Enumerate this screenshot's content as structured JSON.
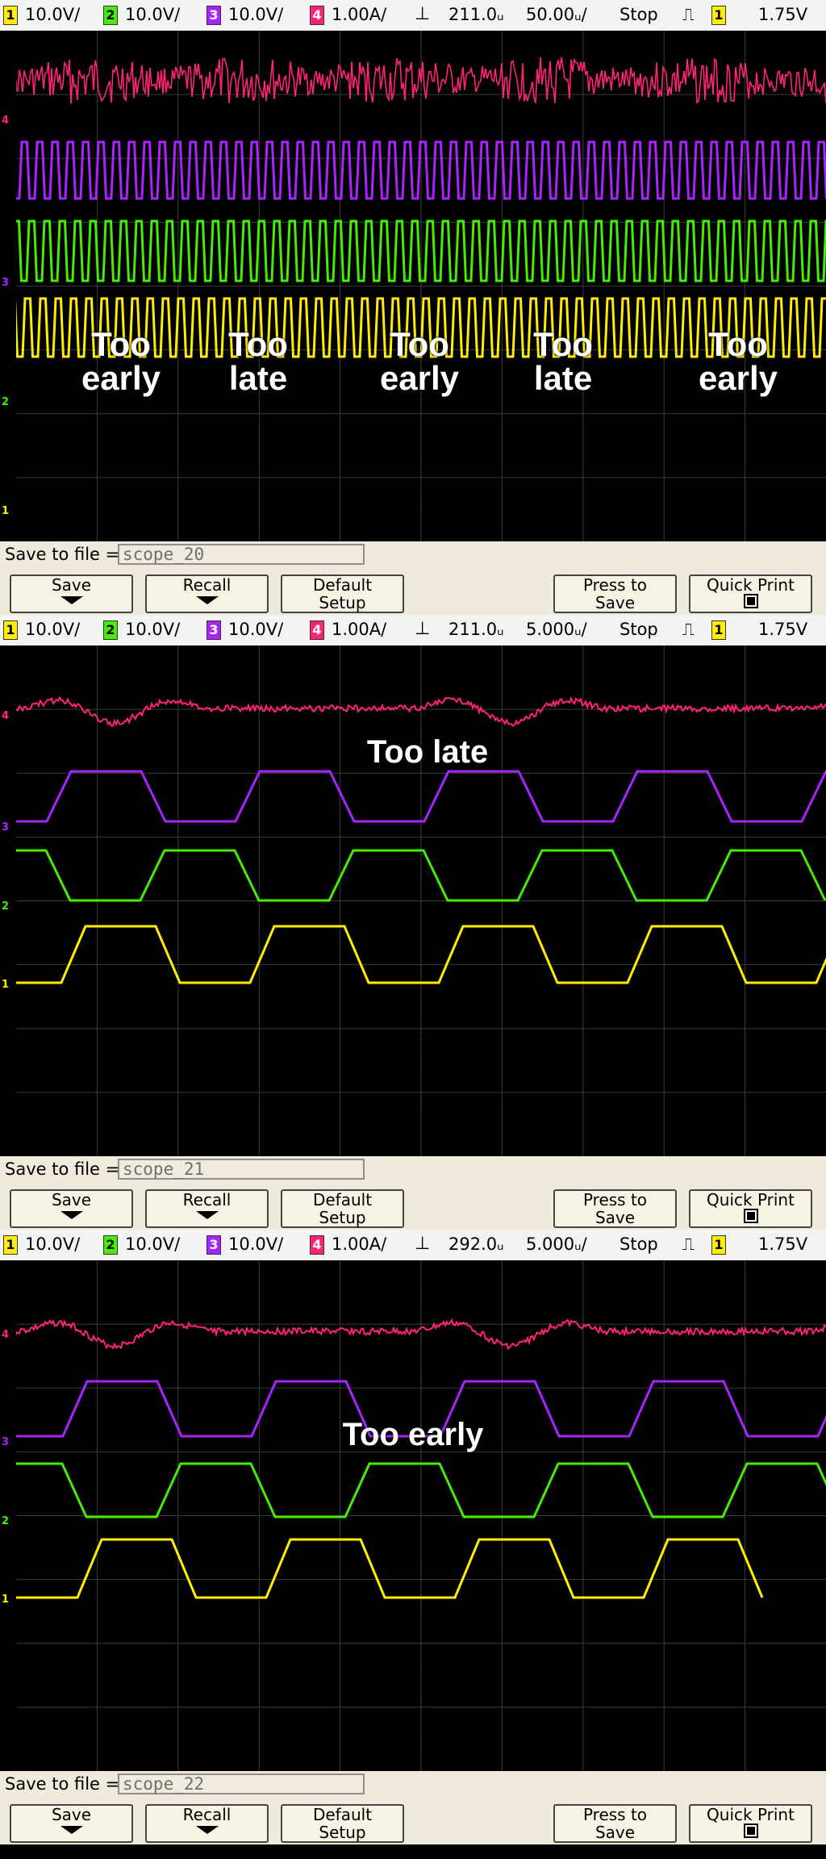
{
  "panels": [
    {
      "status": {
        "ch1": "10.0V/",
        "ch2": "10.0V/",
        "ch3": "10.0V/",
        "ch4": "1.00A/",
        "delay": "211.0ᵤ",
        "timebase": "50.00ᵤ/",
        "state": "Stop",
        "trig_ch": "1",
        "trig_level": "1.75V"
      },
      "labels": [
        {
          "lines": [
            "Too",
            "early"
          ]
        },
        {
          "lines": [
            "Too",
            "late"
          ]
        },
        {
          "lines": [
            "Too",
            "early"
          ]
        },
        {
          "lines": [
            "Too",
            "late"
          ]
        },
        {
          "lines": [
            "Too",
            "early"
          ]
        }
      ],
      "softkeys": {
        "save_to_file_label": "Save to file =",
        "file_name": "scope_20",
        "save": "Save",
        "recall": "Recall",
        "default_setup_line1": "Default",
        "default_setup_line2": "Setup",
        "press_to_save_line1": "Press to",
        "press_to_save_line2": "Save",
        "quick_print": "Quick Print"
      }
    },
    {
      "status": {
        "ch1": "10.0V/",
        "ch2": "10.0V/",
        "ch3": "10.0V/",
        "ch4": "1.00A/",
        "delay": "211.0ᵤ",
        "timebase": "5.000ᵤ/",
        "state": "Stop",
        "trig_ch": "1",
        "trig_level": "1.75V"
      },
      "labels": [
        {
          "lines": [
            "Too late"
          ]
        }
      ],
      "softkeys": {
        "save_to_file_label": "Save to file =",
        "file_name": "scope_21",
        "save": "Save",
        "recall": "Recall",
        "default_setup_line1": "Default",
        "default_setup_line2": "Setup",
        "press_to_save_line1": "Press to",
        "press_to_save_line2": "Save",
        "quick_print": "Quick Print"
      }
    },
    {
      "status": {
        "ch1": "10.0V/",
        "ch2": "10.0V/",
        "ch3": "10.0V/",
        "ch4": "1.00A/",
        "delay": "292.0ᵤ",
        "timebase": "5.000ᵤ/",
        "state": "Stop",
        "trig_ch": "1",
        "trig_level": "1.75V"
      },
      "labels": [
        {
          "lines": [
            "Too early"
          ]
        }
      ],
      "softkeys": {
        "save_to_file_label": "Save to file =",
        "file_name": "scope_22",
        "save": "Save",
        "recall": "Recall",
        "default_setup_line1": "Default",
        "default_setup_line2": "Setup",
        "press_to_save_line1": "Press to",
        "press_to_save_line2": "Save",
        "quick_print": "Quick Print"
      }
    }
  ],
  "colors": {
    "ch1": "#ffee00",
    "ch2": "#44ee00",
    "ch3": "#aa22ff",
    "ch4": "#ff2277",
    "grid": "#3a3a3a",
    "label": "#ffffff"
  },
  "icons": {
    "trigger_marker": "trigger-position-icon",
    "rising_edge": "rising-edge-icon",
    "down_arrow": "down-arrow-icon",
    "print_square": "print-icon"
  }
}
